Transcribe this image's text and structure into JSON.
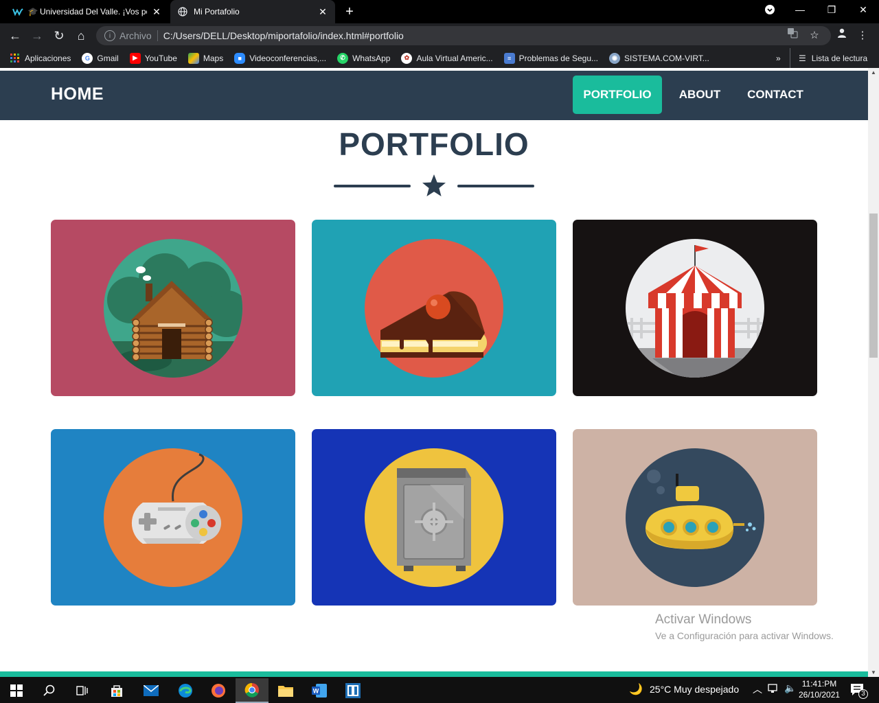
{
  "browser": {
    "tabs": [
      {
        "title": "Universidad Del Valle. ¡Vos po",
        "favicon": "univalle-icon",
        "active": false
      },
      {
        "title": "Mi Portafolio",
        "favicon": "globe-icon",
        "active": true
      }
    ],
    "address": {
      "chip": "Archivo",
      "url": "C:/Users/DELL/Desktop/miportafolio/index.html#portfolio"
    },
    "bookmarks": [
      {
        "label": "Aplicaciones",
        "icon": "apps-grid-icon",
        "color": "#ea4335"
      },
      {
        "label": "Gmail",
        "icon": "google-icon",
        "color": "#4285f4"
      },
      {
        "label": "YouTube",
        "icon": "youtube-icon",
        "color": "#ff0000"
      },
      {
        "label": "Maps",
        "icon": "maps-icon",
        "color": "#34a853"
      },
      {
        "label": "Videoconferencias,...",
        "icon": "zoom-icon",
        "color": "#2d8cff"
      },
      {
        "label": "WhatsApp",
        "icon": "whatsapp-icon",
        "color": "#25d366"
      },
      {
        "label": "Aula Virtual Americ...",
        "icon": "aula-icon",
        "color": "#c0392b"
      },
      {
        "label": "Problemas de Segu...",
        "icon": "doc-icon",
        "color": "#4a7bd0"
      },
      {
        "label": "SISTEMA.COM-VIRT...",
        "icon": "sistema-icon",
        "color": "#8aa6c8"
      }
    ],
    "reading_list": "Lista de lectura"
  },
  "site": {
    "brand": "HOME",
    "nav": [
      {
        "label": "PORTFOLIO",
        "active": true
      },
      {
        "label": "ABOUT",
        "active": false
      },
      {
        "label": "CONTACT",
        "active": false
      }
    ],
    "section_title": "PORTFOLIO",
    "accent": "#1abc9c",
    "primary": "#2c3e50",
    "portfolio": [
      {
        "illustration": "cabin-icon",
        "background": "#b64a63",
        "circle": "#3fa68b"
      },
      {
        "illustration": "cake-icon",
        "background": "#20a2b4",
        "circle": "#e05a48"
      },
      {
        "illustration": "circus-tent-icon",
        "background": "#161212",
        "circle": "#ecedef"
      },
      {
        "illustration": "game-controller-icon",
        "background": "#1f84c3",
        "circle": "#e67d3b"
      },
      {
        "illustration": "safe-icon",
        "background": "#1534b6",
        "circle": "#efc33e"
      },
      {
        "illustration": "submarine-icon",
        "background": "#cdb2a5",
        "circle": "#34495e"
      }
    ]
  },
  "watermark": {
    "line1": "Activar Windows",
    "line2": "Ve a Configuración para activar Windows."
  },
  "taskbar": {
    "weather": "25°C  Muy despejado",
    "time": "11:41:PM",
    "date": "26/10/2021",
    "notifications": "3"
  }
}
